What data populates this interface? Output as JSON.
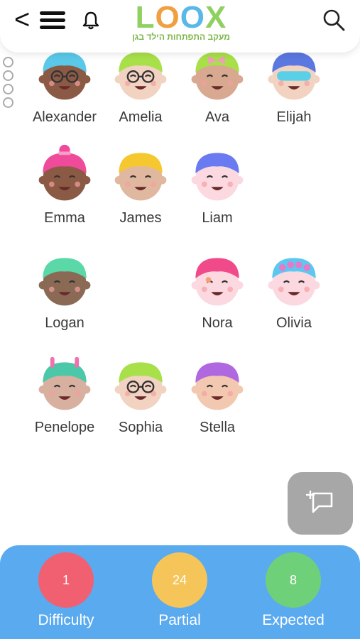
{
  "header": {
    "back_label": "<",
    "logo_text": "LOOX",
    "logo_subtitle": "מעקב התפתחות הילד בגן",
    "icons": [
      "menu-icon",
      "bell-icon",
      "search-icon"
    ]
  },
  "children": [
    {
      "name": "Alexander",
      "hair": "#5ac8e8",
      "skin": "#8a5a45",
      "style": "glasses"
    },
    {
      "name": "Amelia",
      "hair": "#a8e04a",
      "skin": "#f2d2c0",
      "style": "glasses"
    },
    {
      "name": "Ava",
      "hair": "#a8e04a",
      "skin": "#d8a890",
      "style": "bow"
    },
    {
      "name": "Elijah",
      "hair": "#5a78e0",
      "skin": "#f2d2c0",
      "style": "mask"
    },
    {
      "name": "Emma",
      "hair": "#f04a9a",
      "skin": "#8a5a45",
      "style": "bun"
    },
    {
      "name": "James",
      "hair": "#f5c830",
      "skin": "#e0b8a0",
      "style": "plain"
    },
    {
      "name": "Liam",
      "hair": "#6a7af0",
      "skin": "#fcd8e0",
      "style": "plain"
    },
    {
      "name": "Logan",
      "hair": "#5ad8a8",
      "skin": "#8a6a55",
      "style": "plain"
    },
    {
      "name": "Nora",
      "hair": "#f04a8a",
      "skin": "#fcd8e0",
      "style": "bangs"
    },
    {
      "name": "Olivia",
      "hair": "#5ac8f0",
      "skin": "#fcd8e0",
      "style": "flowers"
    },
    {
      "name": "Penelope",
      "hair": "#4ac8a8",
      "skin": "#d8b0a0",
      "style": "ears"
    },
    {
      "name": "Sophia",
      "hair": "#a8e04a",
      "skin": "#f2d2c0",
      "style": "glasses"
    },
    {
      "name": "Stella",
      "hair": "#b068e0",
      "skin": "#f2c8b0",
      "style": "plain"
    }
  ],
  "fab_icon": "add-note-icon",
  "footer": {
    "stats": [
      {
        "count": "1",
        "label": "Difficulty",
        "color": "#f06070"
      },
      {
        "count": "24",
        "label": "Partial",
        "color": "#f5c55a"
      },
      {
        "count": "8",
        "label": "Expected",
        "color": "#6fd07a"
      }
    ]
  }
}
